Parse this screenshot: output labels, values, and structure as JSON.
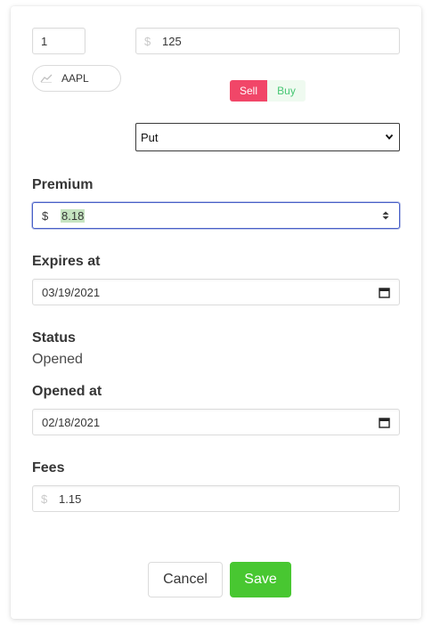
{
  "position": {
    "quantity": "1",
    "strike_currency": "$",
    "strike": "125",
    "ticker": "AAPL",
    "ticker_icon": "chart-line-icon",
    "side_options": [
      "Sell",
      "Buy"
    ],
    "selected_side": "Sell",
    "option_type": "Put"
  },
  "premium": {
    "label": "Premium",
    "currency": "$",
    "value": "8.18"
  },
  "expires": {
    "label": "Expires at",
    "value": "03/19/2021"
  },
  "status": {
    "label": "Status",
    "value": "Opened"
  },
  "opened": {
    "label": "Opened at",
    "value": "02/18/2021"
  },
  "fees": {
    "label": "Fees",
    "currency": "$",
    "value": "1.15"
  },
  "actions": {
    "cancel": "Cancel",
    "save": "Save"
  },
  "colors": {
    "sell": "#f14668",
    "buy_bg": "#effaf0",
    "buy_text": "#48c774",
    "save": "#48c731",
    "focus": "#485fc7"
  }
}
